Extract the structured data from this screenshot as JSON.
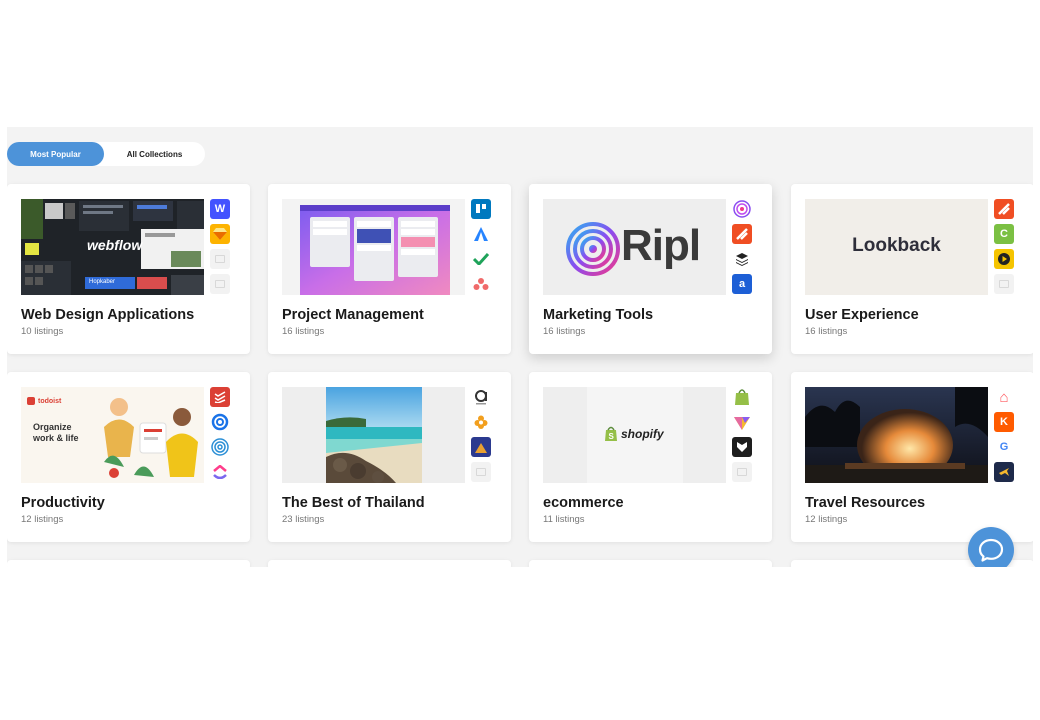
{
  "tabs": {
    "most_popular": "Most Popular",
    "all_collections": "All Collections"
  },
  "thumb_text": {
    "webflow": "webflow",
    "webflow_badge": "Hopkaber",
    "ripl": "Ripl",
    "lookback": "Lookback",
    "todoist_brand": "todoist",
    "todoist_tagline": "Organize work & life",
    "shopify": "shopify"
  },
  "collections": [
    {
      "title": "Web Design Applications",
      "count": "10 listings"
    },
    {
      "title": "Project Management",
      "count": "16 listings"
    },
    {
      "title": "Marketing Tools",
      "count": "16 listings"
    },
    {
      "title": "User Experience",
      "count": "16 listings"
    },
    {
      "title": "Productivity",
      "count": "12 listings"
    },
    {
      "title": "The Best of Thailand",
      "count": "23 listings"
    },
    {
      "title": "ecommerce",
      "count": "11 listings"
    },
    {
      "title": "Travel Resources",
      "count": "12 listings"
    }
  ],
  "icons": {
    "webflow_icon": "W",
    "airbnb_icon": "⌂",
    "klook_icon": "K",
    "google_icon": "G",
    "appsumo_icon": "a",
    "clickup_icon": "C"
  },
  "colors": {
    "accent": "#4d93d9",
    "panel": "#f3f3f3"
  }
}
